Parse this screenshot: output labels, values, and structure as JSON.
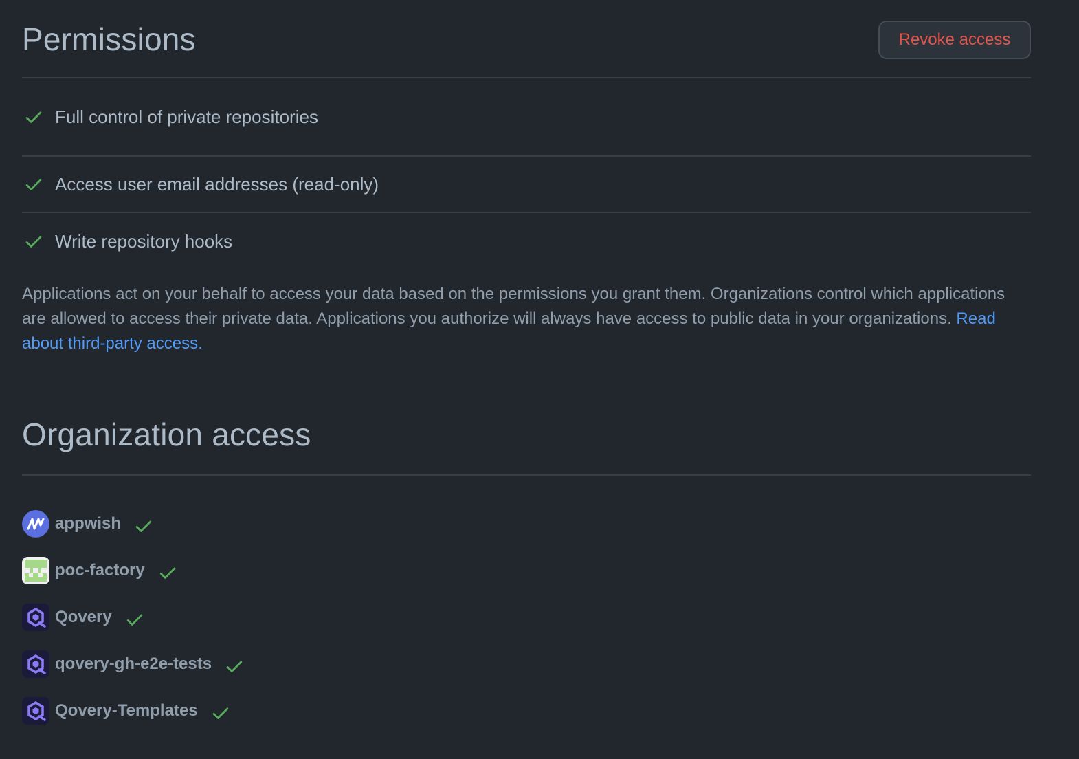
{
  "permissions": {
    "title": "Permissions",
    "revoke_label": "Revoke access",
    "items": [
      {
        "label": "Full control of private repositories",
        "icon": "check-icon"
      },
      {
        "label": "Access user email addresses (read-only)",
        "icon": "check-icon"
      },
      {
        "label": "Write repository hooks",
        "icon": "check-icon"
      }
    ],
    "description": "Applications act on your behalf to access your data based on the permissions you grant them. Organizations control which applications are allowed to access their private data. Applications you authorize will always have access to public data in your organizations.",
    "link_label": "Read about third-party access."
  },
  "organizations": {
    "title": "Organization access",
    "items": [
      {
        "name": "appwish",
        "avatar": "appwish-logo",
        "granted": true
      },
      {
        "name": "poc-factory",
        "avatar": "poc-factory-identicon",
        "granted": true
      },
      {
        "name": "Qovery",
        "avatar": "qovery-logo",
        "granted": true
      },
      {
        "name": "qovery-gh-e2e-tests",
        "avatar": "qovery-logo",
        "granted": true
      },
      {
        "name": "Qovery-Templates",
        "avatar": "qovery-logo",
        "granted": true
      }
    ]
  },
  "colors": {
    "background": "#22272e",
    "check": "#57ab5a",
    "danger": "#e5534b",
    "link": "#539bf5"
  }
}
